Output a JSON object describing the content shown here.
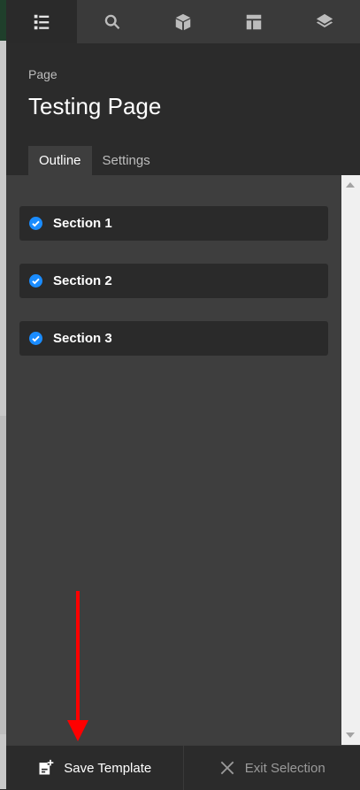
{
  "toolbar": {
    "items": [
      {
        "name": "outline",
        "icon": "list-icon",
        "active": true
      },
      {
        "name": "search",
        "icon": "search-icon",
        "active": false
      },
      {
        "name": "components",
        "icon": "cube-icon",
        "active": false
      },
      {
        "name": "layout",
        "icon": "layout-icon",
        "active": false
      },
      {
        "name": "layers",
        "icon": "layers-icon",
        "active": false
      }
    ]
  },
  "header": {
    "kicker": "Page",
    "title": "Testing Page",
    "tabs": [
      {
        "label": "Outline",
        "active": true
      },
      {
        "label": "Settings",
        "active": false
      }
    ]
  },
  "outline": {
    "sections": [
      {
        "label": "Section 1",
        "checked": true
      },
      {
        "label": "Section 2",
        "checked": true
      },
      {
        "label": "Section 3",
        "checked": true
      }
    ]
  },
  "footer": {
    "save_label": "Save Template",
    "exit_label": "Exit Selection"
  },
  "colors": {
    "accent": "#1a8cff",
    "annotation": "#ff0000"
  }
}
